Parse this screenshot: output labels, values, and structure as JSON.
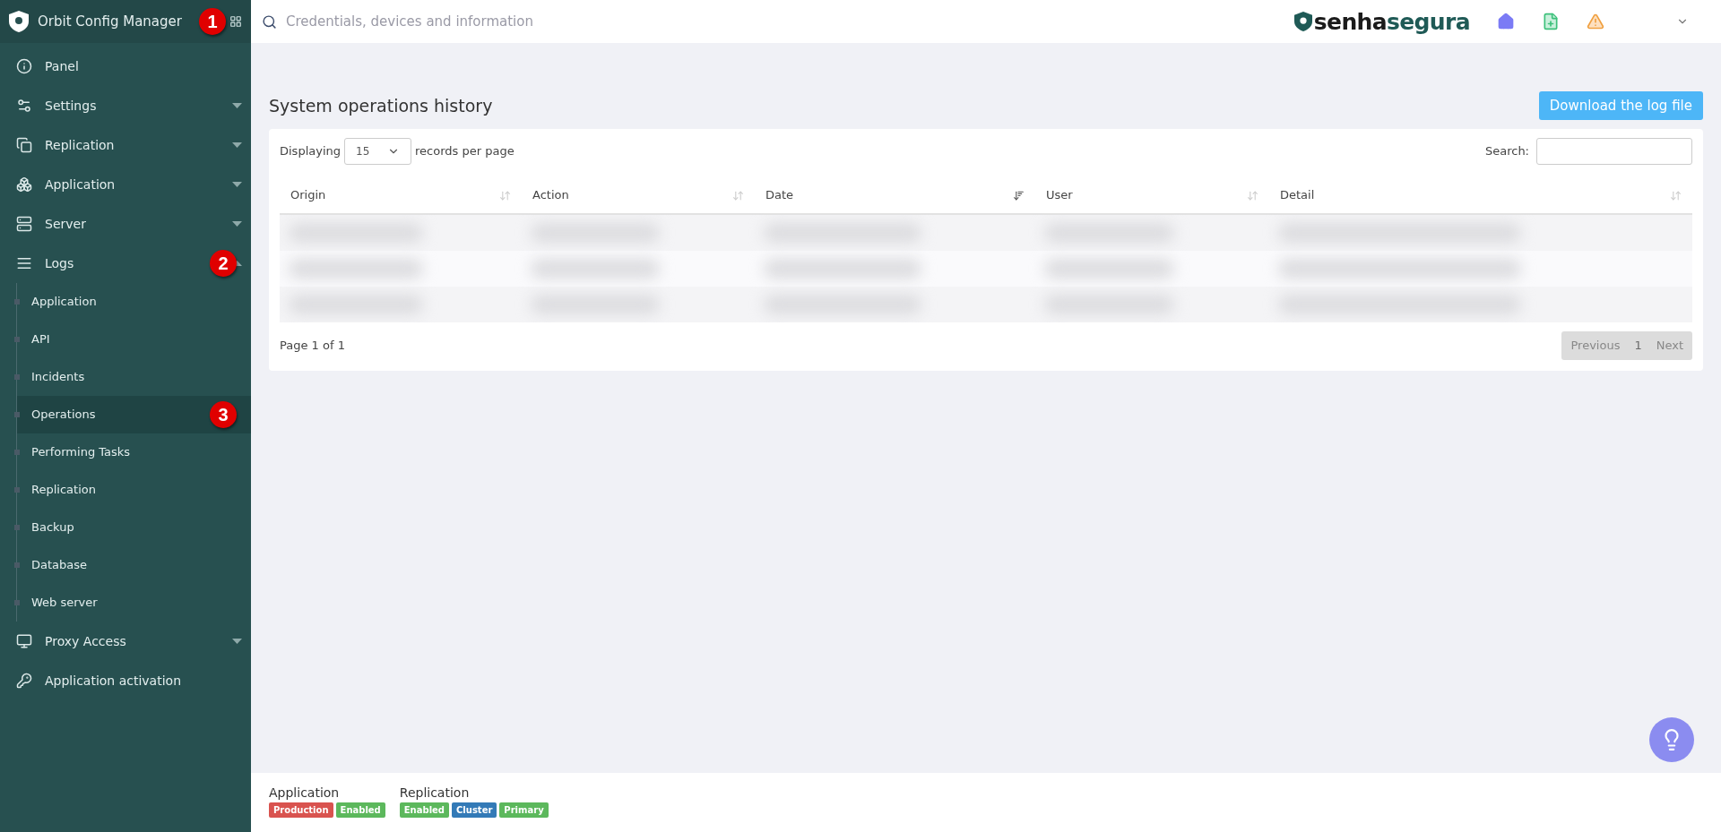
{
  "sidebar": {
    "title": "Orbit Config Manager",
    "marker": "1",
    "items": [
      {
        "label": "Panel"
      },
      {
        "label": "Settings",
        "expanded": false
      },
      {
        "label": "Replication",
        "expanded": false
      },
      {
        "label": "Application",
        "expanded": false
      },
      {
        "label": "Server",
        "expanded": false
      },
      {
        "label": "Logs",
        "expanded": true,
        "marker": "2",
        "children": [
          {
            "label": "Application",
            "selected": false
          },
          {
            "label": "API",
            "selected": false
          },
          {
            "label": "Incidents",
            "selected": false
          },
          {
            "label": "Operations",
            "selected": true,
            "marker": "3"
          },
          {
            "label": "Performing Tasks",
            "selected": false
          },
          {
            "label": "Replication",
            "selected": false
          },
          {
            "label": "Backup",
            "selected": false
          },
          {
            "label": "Database",
            "selected": false
          },
          {
            "label": "Web server",
            "selected": false
          }
        ]
      },
      {
        "label": "Proxy Access",
        "expanded": false
      },
      {
        "label": "Application activation"
      }
    ]
  },
  "topbar": {
    "search": {
      "placeholder": "Credentials, devices and information"
    },
    "logo": [
      "senha",
      "segura"
    ]
  },
  "page": {
    "title": "System operations history",
    "download_button": "Download the log file"
  },
  "table": {
    "length_prefix": "Displaying",
    "length_value": "15",
    "length_suffix": "records per page",
    "search_label": "Search:",
    "columns": [
      {
        "label": "Origin",
        "sorted": false
      },
      {
        "label": "Action",
        "sorted": false
      },
      {
        "label": "Date",
        "sorted": true
      },
      {
        "label": "User",
        "sorted": false
      },
      {
        "label": "Detail",
        "sorted": false
      }
    ],
    "rows": [
      {
        "kind": "blurred"
      },
      {
        "kind": "blurred"
      },
      {
        "kind": "blurred"
      }
    ],
    "info": "Page 1 of 1",
    "pagination": {
      "previous": "Previous",
      "page": "1",
      "next": "Next"
    }
  },
  "footer": [
    {
      "label": "Application",
      "badges": [
        {
          "text": "Production",
          "color": "#d9534f"
        },
        {
          "text": "Enabled",
          "color": "#5cb85c"
        }
      ]
    },
    {
      "label": "Replication",
      "badges": [
        {
          "text": "Enabled",
          "color": "#5cb85c"
        },
        {
          "text": "Cluster",
          "color": "#337ab7"
        },
        {
          "text": "Primary",
          "color": "#5cb85c"
        }
      ]
    }
  ]
}
